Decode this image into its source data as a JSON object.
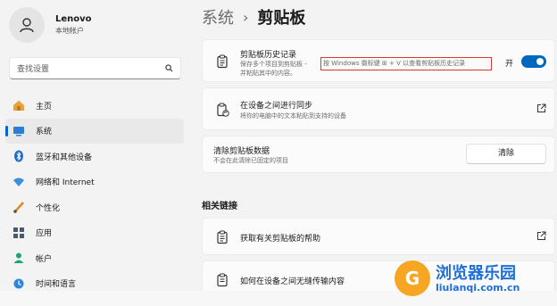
{
  "user": {
    "name": "Lenovo",
    "account": "本地帐户"
  },
  "search": {
    "placeholder": "查找设置"
  },
  "nav": [
    {
      "label": "主页",
      "icon": "home-icon"
    },
    {
      "label": "系统",
      "icon": "system-icon",
      "active": true
    },
    {
      "label": "蓝牙和其他设备",
      "icon": "bluetooth-icon"
    },
    {
      "label": "网络和 Internet",
      "icon": "network-icon"
    },
    {
      "label": "个性化",
      "icon": "brush-icon"
    },
    {
      "label": "应用",
      "icon": "apps-icon"
    },
    {
      "label": "帐户",
      "icon": "account-icon"
    },
    {
      "label": "时间和语言",
      "icon": "time-language-icon"
    }
  ],
  "breadcrumb": {
    "parent": "系统",
    "separator": "›",
    "current": "剪贴板"
  },
  "clipboard_history": {
    "title": "剪贴板历史记录",
    "desc_line1": "保存多个项目到剪贴板 - ",
    "desc_highlight": "按 Windows 徽标键 ⊞ + V 以查看剪贴板历史记录",
    "desc_line2": "并粘贴其中的内容。",
    "toggle_label": "开",
    "toggle_on": true
  },
  "sync": {
    "title": "在设备之间进行同步",
    "desc": "将你的电脑中的文本粘贴到支持的设备"
  },
  "clear": {
    "title": "清除剪贴板数据",
    "desc": "不会在此清除已固定的项目",
    "button": "清除"
  },
  "related": {
    "heading": "相关链接",
    "help": "获取有关剪贴板的帮助",
    "transfer": "如何在设备之间无缝传输内容"
  },
  "watermark": {
    "logo": "G",
    "title": "浏览器乐园",
    "url": "liulanqi.com.cn"
  },
  "colors": {
    "accent": "#0067c0",
    "highlight_border": "#d63a2e",
    "watermark": "#1e6fd9"
  }
}
